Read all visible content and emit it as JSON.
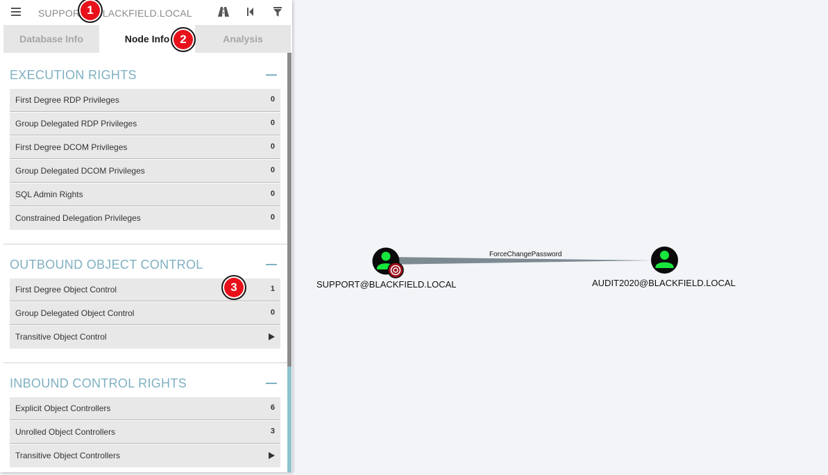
{
  "search": {
    "value": "SUPPORT@BLACKFIELD.LOCAL"
  },
  "toolbar": {
    "menu_icon": "hamburger-icon",
    "icons": [
      "road-icon",
      "back-icon",
      "filter-icon"
    ]
  },
  "tabs": [
    {
      "label": "Database Info",
      "active": false
    },
    {
      "label": "Node Info",
      "active": true
    },
    {
      "label": "Analysis",
      "active": false
    }
  ],
  "sections": {
    "execution": {
      "title": "EXECUTION RIGHTS",
      "rows": [
        {
          "label": "First Degree RDP Privileges",
          "value": "0"
        },
        {
          "label": "Group Delegated RDP Privileges",
          "value": "0"
        },
        {
          "label": "First Degree DCOM Privileges",
          "value": "0"
        },
        {
          "label": "Group Delegated DCOM Privileges",
          "value": "0"
        },
        {
          "label": "SQL Admin Rights",
          "value": "0"
        },
        {
          "label": "Constrained Delegation Privileges",
          "value": "0"
        }
      ]
    },
    "outbound": {
      "title": "OUTBOUND OBJECT CONTROL",
      "rows": [
        {
          "label": "First Degree Object Control",
          "value": "1"
        },
        {
          "label": "Group Delegated Object Control",
          "value": "0"
        },
        {
          "label": "Transitive Object Control",
          "value": ""
        }
      ]
    },
    "inbound": {
      "title": "INBOUND CONTROL RIGHTS",
      "rows": [
        {
          "label": "Explicit Object Controllers",
          "value": "6"
        },
        {
          "label": "Unrolled Object Controllers",
          "value": "3"
        },
        {
          "label": "Transitive Object Controllers",
          "value": ""
        }
      ]
    }
  },
  "badges": [
    "1",
    "2",
    "3"
  ],
  "graph": {
    "edge_label": "ForceChangePassword",
    "source_node": "SUPPORT@BLACKFIELD.LOCAL",
    "target_node": "AUDIT2020@BLACKFIELD.LOCAL"
  },
  "colors": {
    "accent": "#7fb0c2",
    "badge": "#e8101a",
    "user_node": "#17e63d",
    "edge": "#7d8a92"
  }
}
